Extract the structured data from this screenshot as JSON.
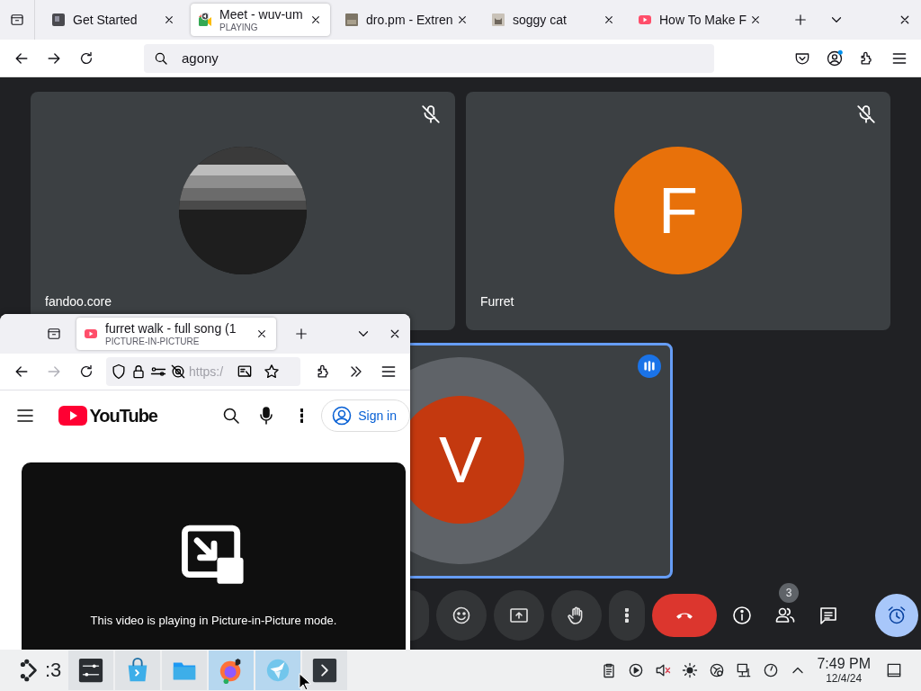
{
  "browser": {
    "tabs": [
      {
        "title": "Get Started",
        "selected": false
      },
      {
        "title": "Meet - wuv-um",
        "subtitle": "PLAYING",
        "selected": true
      },
      {
        "title": "dro.pm - Extren",
        "selected": false
      },
      {
        "title": "soggy cat",
        "selected": false
      },
      {
        "title": "How To Make F",
        "selected": false
      }
    ],
    "address_bar": {
      "value": "agony"
    }
  },
  "meet": {
    "tiles": [
      {
        "name": "fandoo.core",
        "kind": "picture",
        "muted": true,
        "speaking": false
      },
      {
        "name": "Furret",
        "kind": "letter",
        "letter": "F",
        "color": "#e8710a",
        "muted": true,
        "speaking": false
      },
      {
        "kind": "letter",
        "letter": "V",
        "color": "#c4390f",
        "muted": false,
        "speaking": true
      }
    ],
    "people_badge": "3"
  },
  "pip_window": {
    "tab": {
      "title": "furret walk - full song (1",
      "subtitle": "PICTURE-IN-PICTURE",
      "selected": true
    },
    "address_bar": {
      "value": "https:/"
    },
    "youtube": {
      "logo": "YouTube",
      "sign_in": "Sign in",
      "video_message": "This video is playing in Picture-in-Picture mode."
    }
  },
  "taskbar": {
    "launcher_text": ":3",
    "tasks": [
      {
        "active": false
      },
      {
        "active": false
      },
      {
        "active": false
      },
      {
        "active": true
      },
      {
        "active": true
      },
      {
        "active": false
      }
    ],
    "clock": {
      "time": "7:49 PM",
      "date": "12/4/24"
    }
  }
}
